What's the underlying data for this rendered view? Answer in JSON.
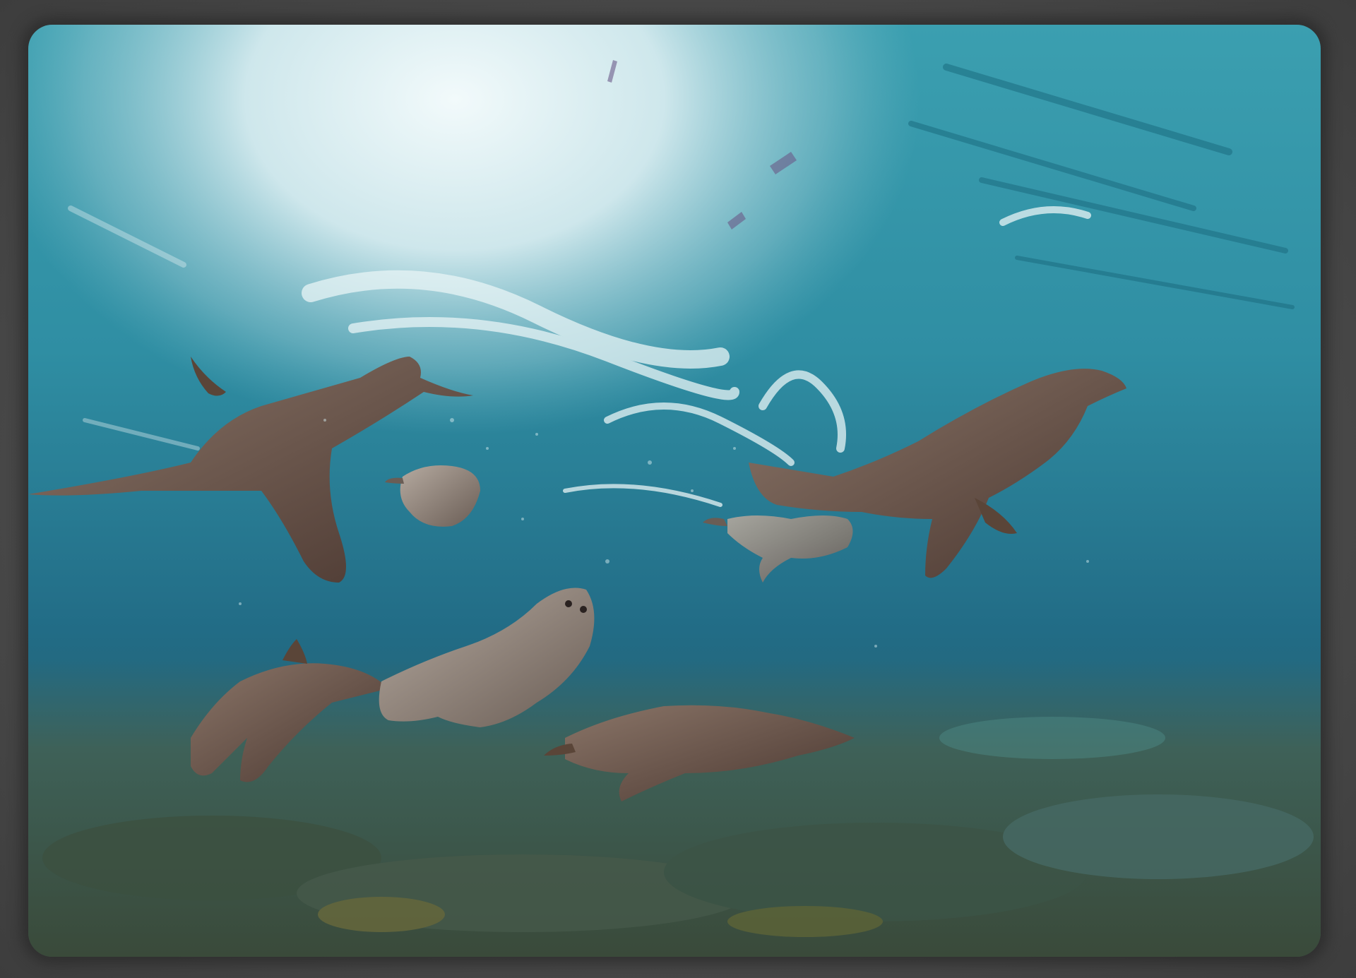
{
  "scene": {
    "subject": "",
    "creature_count": 8,
    "colors": {
      "frame": "#4a4a4a",
      "water_light": "#dcecef",
      "water_mid": "#2f8fa2",
      "water_deep": "#1d5f78",
      "seafloor": "#3f5a4a",
      "sea_lion_dark": "#4e3b33",
      "sea_lion_light": "#a99a8e"
    }
  }
}
